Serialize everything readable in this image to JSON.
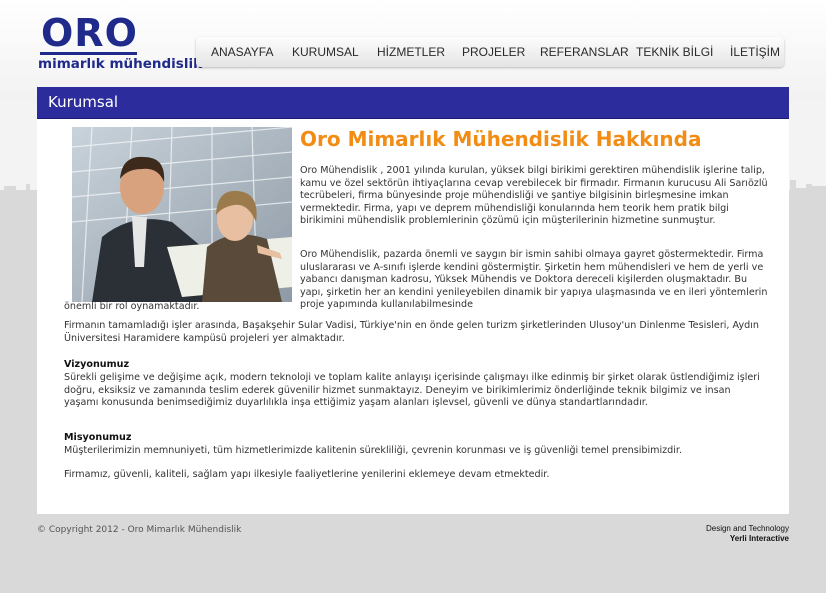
{
  "brand": {
    "name": "ORO",
    "tagline": "mimarlık mühendislik",
    "color": "#1f2a8a"
  },
  "nav": {
    "items": [
      {
        "label": "ANASAYFA"
      },
      {
        "label": "KURUMSAL"
      },
      {
        "label": "HİZMETLER"
      },
      {
        "label": "PROJELER"
      },
      {
        "label": "REFERANSLAR"
      },
      {
        "label": "TEKNİK BİLGİ"
      },
      {
        "label": "İLETİŞİM"
      }
    ]
  },
  "section": {
    "title": "Kurumsal",
    "color": "#2d2c9d"
  },
  "about": {
    "heading": "Oro Mimarlık Mühendislik Hakkında",
    "heading_color": "#f28c14",
    "p1": "Oro Mühendislik , 2001 yılında kurulan, yüksek bilgi birikimi gerektiren mühendislik işlerine talip, kamu ve özel sektörün ihtiyaçlarına cevap verebilecek bir firmadır. Firmanın kurucusu Ali Sarıözlü tecrübeleri, firma bünyesinde proje mühendisliği ve şantiye bilgisinin birleşmesine imkan vermektedir. Firma, yapı ve deprem mühendisliği konularında hem teorik hem pratik bilgi birikimini mühendislik problemlerinin çözümü için müşterilerinin hizmetine sunmuştur.",
    "p2": "Oro Mühendislik, pazarda önemli ve saygın bir ismin sahibi olmaya gayret göstermektedir. Firma uluslararası ve A-sınıfı işlerde kendini göstermiştir. Şirketin hem mühendisleri ve hem de yerli ve yabancı danışman kadrosu, Yüksek Mühendis ve Doktora dereceli kişilerden oluşmaktadır. Bu yapı, şirketin her an kendini yenileyebilen dinamik bir yapıya ulaşmasında ve en ileri yöntemlerin proje yapımında kullanılabilmesinde",
    "p2_cont": "önemli bir rol oynamaktadır.",
    "p3": "Firmanın tamamladığı işler arasında, Başakşehir Sular Vadisi, Türkiye'nin en önde gelen turizm şirketlerinden Ulusoy'un Dinlenme Tesisleri, Aydın Üniversitesi Haramidere kampüsü projeleri yer almaktadır.",
    "vision_title": "Vizyonumuz",
    "vision_text": "Sürekli gelişime ve değişime açık, modern teknoloji ve toplam kalite anlayışı içerisinde çalışmayı ilke edinmiş bir şirket olarak üstlendiğimiz işleri doğru, eksiksiz ve zamanında teslim ederek güvenilir hizmet sunmaktayız. Deneyim ve birikimlerimiz önderliğinde teknik bilgimiz ve insan yaşamı konusunda benimsediğimiz duyarlılıkla inşa ettiğimiz yaşam alanları işlevsel, güvenli ve dünya standartlarındadır.",
    "mission_title": "Misyonumuz",
    "mission_text": "Müşterilerimizin memnuniyeti, tüm hizmetlerimizde kalitenin sürekliliği, çevrenin korunması ve iş güvenliği temel prensibimizdir.",
    "closing": "Firmamız, güvenli, kaliteli, sağlam yapı ilkesiyle faaliyetlerine yenilerini eklemeye devam etmektedir."
  },
  "footer": {
    "copyright": "© Copyright 2012 - Oro Mimarlık Mühendislik",
    "credit_line1": "Design and Technology",
    "credit_line2": "Yerli Interactive"
  }
}
